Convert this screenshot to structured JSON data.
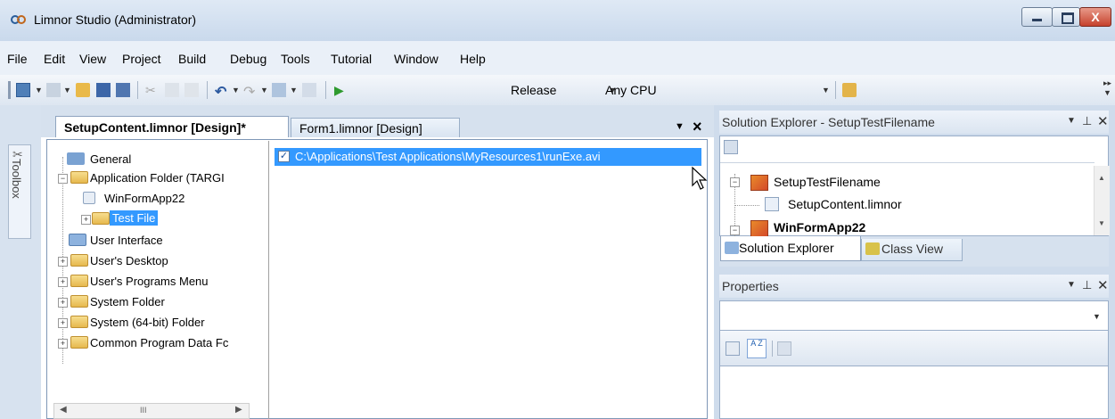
{
  "window": {
    "title": "Limnor Studio (Administrator)",
    "close_glyph": "X"
  },
  "menu": [
    "File",
    "Edit",
    "View",
    "Project",
    "Build",
    "Debug",
    "Tools",
    "Tutorial",
    "Window",
    "Help"
  ],
  "toolbar": {
    "config": "Release",
    "platform": "Any CPU"
  },
  "left_strip": {
    "toolbox_label": "Toolbox"
  },
  "doc_tabs": {
    "active": "SetupContent.limnor [Design]*",
    "inactive": "Form1.limnor [Design]"
  },
  "tree": {
    "items": [
      {
        "label": "General"
      },
      {
        "label": "Application Folder (TARGI"
      },
      {
        "label": "WinFormApp22"
      },
      {
        "label": "Test File"
      },
      {
        "label": "User Interface"
      },
      {
        "label": "User's Desktop"
      },
      {
        "label": "User's Programs Menu"
      },
      {
        "label": "System Folder"
      },
      {
        "label": "System (64-bit) Folder"
      },
      {
        "label": "Common Program Data Fc"
      }
    ],
    "scroll_thumb": "III"
  },
  "files": [
    {
      "path": "C:\\Applications\\Test Applications\\MyResources1\\runExe.avi",
      "checked": true
    }
  ],
  "solution_explorer": {
    "title": "Solution Explorer - SetupTestFilename",
    "items": [
      "SetupTestFilename",
      "SetupContent.limnor",
      "WinFormApp22"
    ],
    "tabs": [
      "Solution Explorer",
      "Class View"
    ]
  },
  "properties": {
    "title": "Properties",
    "sort_label": "A Z"
  },
  "colors": {
    "selection": "#3399ff",
    "chrome": "#cfdcec"
  }
}
